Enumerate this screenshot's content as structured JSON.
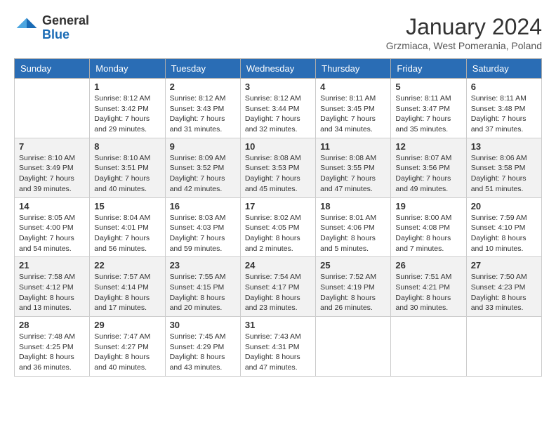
{
  "logo": {
    "general": "General",
    "blue": "Blue"
  },
  "header": {
    "title": "January 2024",
    "subtitle": "Grzmiaca, West Pomerania, Poland"
  },
  "weekdays": [
    "Sunday",
    "Monday",
    "Tuesday",
    "Wednesday",
    "Thursday",
    "Friday",
    "Saturday"
  ],
  "weeks": [
    [
      {
        "day": "",
        "info": ""
      },
      {
        "day": "1",
        "info": "Sunrise: 8:12 AM\nSunset: 3:42 PM\nDaylight: 7 hours\nand 29 minutes."
      },
      {
        "day": "2",
        "info": "Sunrise: 8:12 AM\nSunset: 3:43 PM\nDaylight: 7 hours\nand 31 minutes."
      },
      {
        "day": "3",
        "info": "Sunrise: 8:12 AM\nSunset: 3:44 PM\nDaylight: 7 hours\nand 32 minutes."
      },
      {
        "day": "4",
        "info": "Sunrise: 8:11 AM\nSunset: 3:45 PM\nDaylight: 7 hours\nand 34 minutes."
      },
      {
        "day": "5",
        "info": "Sunrise: 8:11 AM\nSunset: 3:47 PM\nDaylight: 7 hours\nand 35 minutes."
      },
      {
        "day": "6",
        "info": "Sunrise: 8:11 AM\nSunset: 3:48 PM\nDaylight: 7 hours\nand 37 minutes."
      }
    ],
    [
      {
        "day": "7",
        "info": "Sunrise: 8:10 AM\nSunset: 3:49 PM\nDaylight: 7 hours\nand 39 minutes."
      },
      {
        "day": "8",
        "info": "Sunrise: 8:10 AM\nSunset: 3:51 PM\nDaylight: 7 hours\nand 40 minutes."
      },
      {
        "day": "9",
        "info": "Sunrise: 8:09 AM\nSunset: 3:52 PM\nDaylight: 7 hours\nand 42 minutes."
      },
      {
        "day": "10",
        "info": "Sunrise: 8:08 AM\nSunset: 3:53 PM\nDaylight: 7 hours\nand 45 minutes."
      },
      {
        "day": "11",
        "info": "Sunrise: 8:08 AM\nSunset: 3:55 PM\nDaylight: 7 hours\nand 47 minutes."
      },
      {
        "day": "12",
        "info": "Sunrise: 8:07 AM\nSunset: 3:56 PM\nDaylight: 7 hours\nand 49 minutes."
      },
      {
        "day": "13",
        "info": "Sunrise: 8:06 AM\nSunset: 3:58 PM\nDaylight: 7 hours\nand 51 minutes."
      }
    ],
    [
      {
        "day": "14",
        "info": "Sunrise: 8:05 AM\nSunset: 4:00 PM\nDaylight: 7 hours\nand 54 minutes."
      },
      {
        "day": "15",
        "info": "Sunrise: 8:04 AM\nSunset: 4:01 PM\nDaylight: 7 hours\nand 56 minutes."
      },
      {
        "day": "16",
        "info": "Sunrise: 8:03 AM\nSunset: 4:03 PM\nDaylight: 7 hours\nand 59 minutes."
      },
      {
        "day": "17",
        "info": "Sunrise: 8:02 AM\nSunset: 4:05 PM\nDaylight: 8 hours\nand 2 minutes."
      },
      {
        "day": "18",
        "info": "Sunrise: 8:01 AM\nSunset: 4:06 PM\nDaylight: 8 hours\nand 5 minutes."
      },
      {
        "day": "19",
        "info": "Sunrise: 8:00 AM\nSunset: 4:08 PM\nDaylight: 8 hours\nand 7 minutes."
      },
      {
        "day": "20",
        "info": "Sunrise: 7:59 AM\nSunset: 4:10 PM\nDaylight: 8 hours\nand 10 minutes."
      }
    ],
    [
      {
        "day": "21",
        "info": "Sunrise: 7:58 AM\nSunset: 4:12 PM\nDaylight: 8 hours\nand 13 minutes."
      },
      {
        "day": "22",
        "info": "Sunrise: 7:57 AM\nSunset: 4:14 PM\nDaylight: 8 hours\nand 17 minutes."
      },
      {
        "day": "23",
        "info": "Sunrise: 7:55 AM\nSunset: 4:15 PM\nDaylight: 8 hours\nand 20 minutes."
      },
      {
        "day": "24",
        "info": "Sunrise: 7:54 AM\nSunset: 4:17 PM\nDaylight: 8 hours\nand 23 minutes."
      },
      {
        "day": "25",
        "info": "Sunrise: 7:52 AM\nSunset: 4:19 PM\nDaylight: 8 hours\nand 26 minutes."
      },
      {
        "day": "26",
        "info": "Sunrise: 7:51 AM\nSunset: 4:21 PM\nDaylight: 8 hours\nand 30 minutes."
      },
      {
        "day": "27",
        "info": "Sunrise: 7:50 AM\nSunset: 4:23 PM\nDaylight: 8 hours\nand 33 minutes."
      }
    ],
    [
      {
        "day": "28",
        "info": "Sunrise: 7:48 AM\nSunset: 4:25 PM\nDaylight: 8 hours\nand 36 minutes."
      },
      {
        "day": "29",
        "info": "Sunrise: 7:47 AM\nSunset: 4:27 PM\nDaylight: 8 hours\nand 40 minutes."
      },
      {
        "day": "30",
        "info": "Sunrise: 7:45 AM\nSunset: 4:29 PM\nDaylight: 8 hours\nand 43 minutes."
      },
      {
        "day": "31",
        "info": "Sunrise: 7:43 AM\nSunset: 4:31 PM\nDaylight: 8 hours\nand 47 minutes."
      },
      {
        "day": "",
        "info": ""
      },
      {
        "day": "",
        "info": ""
      },
      {
        "day": "",
        "info": ""
      }
    ]
  ]
}
